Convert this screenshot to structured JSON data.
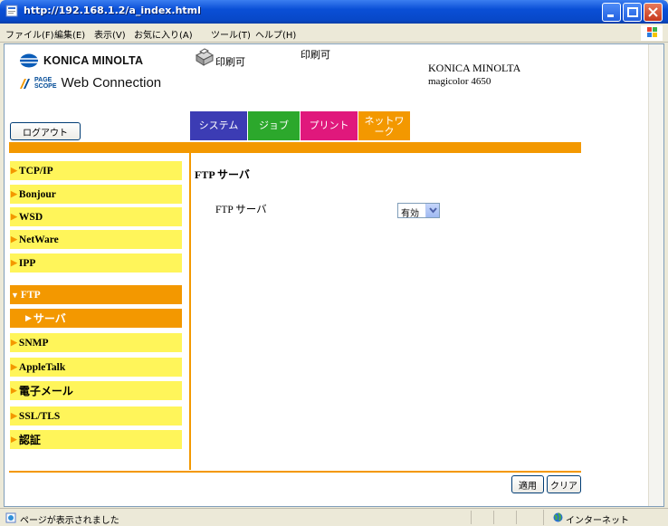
{
  "window": {
    "title": "http://192.168.1.2/a_index.html"
  },
  "menu": {
    "items": [
      "ファイル(F)",
      "編集(E)",
      "表示(V)",
      "お気に入り(A)",
      "ツール(T)",
      "ヘルプ(H)"
    ]
  },
  "header": {
    "brand": "KONICA MINOLTA",
    "pagescope_line1": "PAGE",
    "pagescope_line2": "SCOPE",
    "product": "Web Connection",
    "status_1": "印刷可",
    "status_2": "印刷可",
    "maker": "KONICA MINOLTA",
    "model": "magicolor 4650",
    "logout_label": "ログアウト"
  },
  "tabs": {
    "system": "システム",
    "job": "ジョブ",
    "print": "プリント",
    "network_line1": "ネットワ",
    "network_line2": "ーク"
  },
  "sidebar": {
    "items": [
      {
        "label": "TCP/IP"
      },
      {
        "label": "Bonjour"
      },
      {
        "label": "WSD"
      },
      {
        "label": "NetWare"
      },
      {
        "label": "IPP"
      },
      {
        "label": "FTP"
      },
      {
        "label": "サーバ"
      },
      {
        "label": "SNMP"
      },
      {
        "label": "AppleTalk"
      },
      {
        "label": "電子メール"
      },
      {
        "label": "SSL/TLS"
      },
      {
        "label": "認証"
      }
    ]
  },
  "content": {
    "title": "FTP サーバ",
    "ftp_server_label": "FTP サーバ",
    "ftp_server_value": "有効"
  },
  "buttons": {
    "apply": "適用",
    "clear": "クリア"
  },
  "statusbar": {
    "text": "ページが表示されました",
    "zone": "インターネット"
  },
  "colors": {
    "orange": "#f39800",
    "yellow": "#fff55a",
    "tab_system": "#3c3cb4",
    "tab_job": "#2ca82c",
    "tab_print": "#e0187c",
    "tab_network": "#f39800"
  }
}
